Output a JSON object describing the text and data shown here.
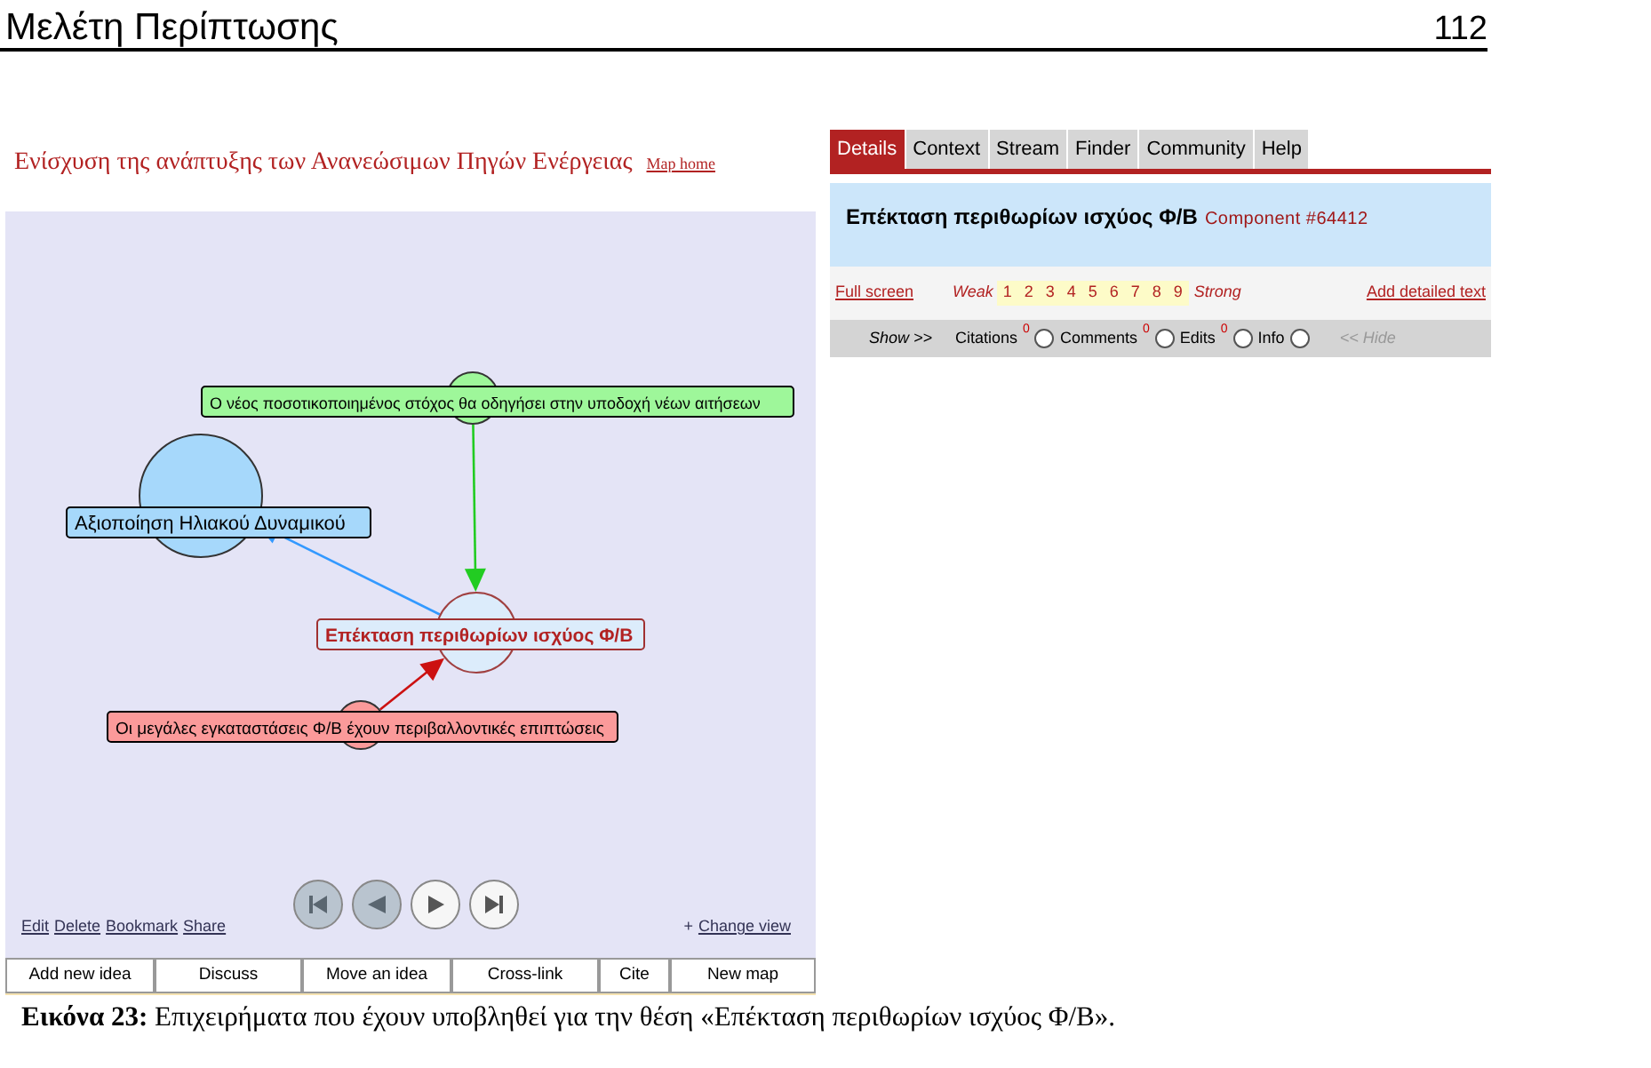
{
  "page_header": {
    "title": "Μελέτη Περίπτωσης",
    "page_number": "112"
  },
  "map_panel": {
    "title": "Ενίσχυση της ανάπτυξης των Ανανεώσιμων Πηγών Ενέργειας",
    "home_link": "Map home",
    "nodes": [
      {
        "label": "Αξιοποίηση Ηλιακού Δυναμικού",
        "color": "#a6d8fb",
        "selected": false,
        "kind": "target"
      },
      {
        "label": "Ο νέος ποσοτικοποιημένος στόχος θα οδηγήσει στην υποδοχή νέων αιτήσεων",
        "color": "#9ef79a",
        "selected": false,
        "kind": "source"
      },
      {
        "label": "Επέκταση περιθωρίων ισχύος Φ/Β",
        "color": "#dcecfb",
        "selected": true,
        "kind": "focus"
      },
      {
        "label": "Οι μεγάλες εγκαταστάσεις Φ/Β έχουν περιβαλλοντικές επιπτώσεις",
        "color": "#fb9a9a",
        "selected": false,
        "kind": "source"
      }
    ],
    "nav_buttons": [
      {
        "kind": "first",
        "disabled": true
      },
      {
        "kind": "previous",
        "disabled": true
      },
      {
        "kind": "next",
        "disabled": false
      },
      {
        "kind": "last",
        "disabled": false
      }
    ],
    "links": [
      "Edit",
      "Delete",
      "Bookmark",
      "Share"
    ],
    "change_view": {
      "prefix": "+",
      "link": "Change view"
    }
  },
  "toolbar": [
    "Add new idea",
    "Discuss",
    "Move an idea",
    "Cross-link",
    "Cite",
    "New map"
  ],
  "tabs": [
    {
      "label": "Details",
      "selected": true
    },
    {
      "label": "Context",
      "selected": false
    },
    {
      "label": "Stream",
      "selected": false
    },
    {
      "label": "Finder",
      "selected": false
    },
    {
      "label": "Community",
      "selected": false
    },
    {
      "label": "Help",
      "selected": false
    }
  ],
  "details": {
    "title": "Επέκταση περιθωρίων ισχύος Φ/Β",
    "component": "Component #64412"
  },
  "rating_bar": {
    "fullscreen": "Full screen",
    "weak": "Weak",
    "steps": [
      "1",
      "2",
      "3",
      "4",
      "5",
      "6",
      "7",
      "8",
      "9"
    ],
    "strong": "Strong",
    "add_text": "Add detailed text"
  },
  "show_bar": {
    "label": "Show >>",
    "options": [
      {
        "label": "Citations",
        "count": "0",
        "checked": false
      },
      {
        "label": "Comments",
        "count": "0",
        "checked": false
      },
      {
        "label": "Edits",
        "count": "0",
        "checked": false
      },
      {
        "label": "Info",
        "checked": false
      }
    ],
    "hide": "<< Hide"
  },
  "caption": {
    "label": "Εικόνα 23:",
    "text": "Επιχειρήματα που έχουν υποβληθεί για την θέση «Επέκταση περιθωρίων ισχύος Φ/Β»."
  }
}
